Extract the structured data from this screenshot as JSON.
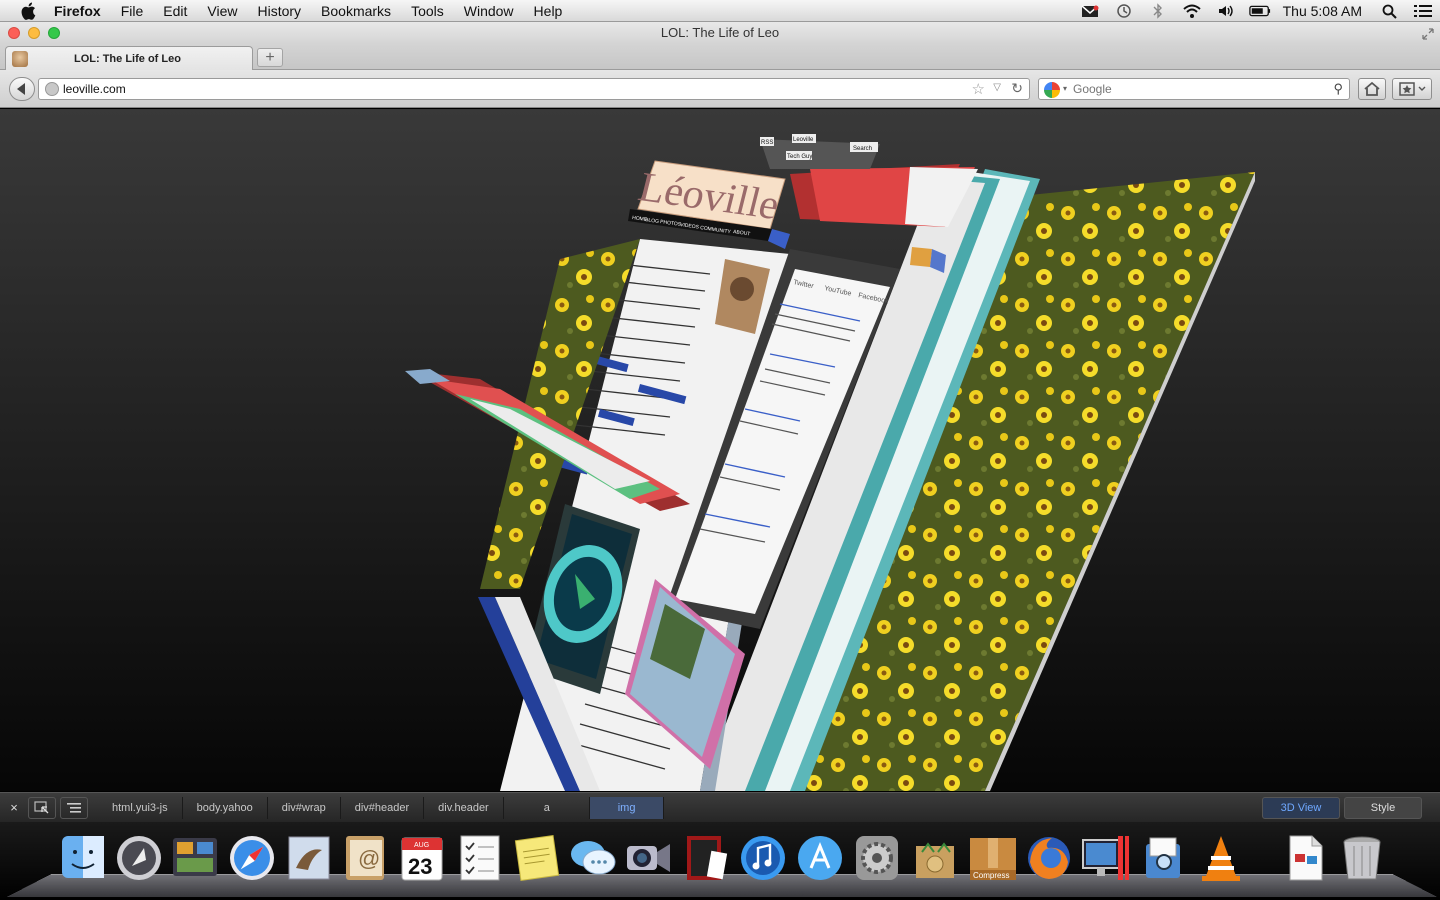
{
  "menubar": {
    "app": "Firefox",
    "items": [
      "File",
      "Edit",
      "View",
      "History",
      "Bookmarks",
      "Tools",
      "Window",
      "Help"
    ],
    "clock": "Thu 5:08 AM"
  },
  "window": {
    "title": "LOL: The Life of Leo"
  },
  "tabs": [
    {
      "label": "LOL: The Life of Leo"
    }
  ],
  "newtab_label": "+",
  "urlbar": {
    "url": "leoville.com"
  },
  "searchbar": {
    "placeholder": "Google"
  },
  "scene": {
    "logo": "Léoville",
    "nav": [
      "HOME",
      "BLOG",
      "PHOTOS",
      "VIDEOS",
      "COMMUNITY",
      "ABOUT"
    ],
    "top_links": [
      "RSS",
      "Leoville",
      "Tech Guy"
    ],
    "search_label": "Search",
    "widget_tabs": [
      "Twitter",
      "YouTube",
      "Facebook"
    ]
  },
  "devtools": {
    "close": "×",
    "breadcrumbs": [
      "html.yui3-js",
      "body.yahoo",
      "div#wrap",
      "div#header",
      "div.header",
      "a",
      "img"
    ],
    "view3d": "3D View",
    "style": "Style"
  },
  "dock": {
    "compress_label": "Compress",
    "calendar_month": "AUG",
    "calendar_day": "23"
  },
  "colors": {
    "accent": "#3b75d9",
    "devtools_active": "#6fa8ff",
    "close": "#fc5f57",
    "minimize": "#fdbc40",
    "zoom": "#34c84a"
  }
}
